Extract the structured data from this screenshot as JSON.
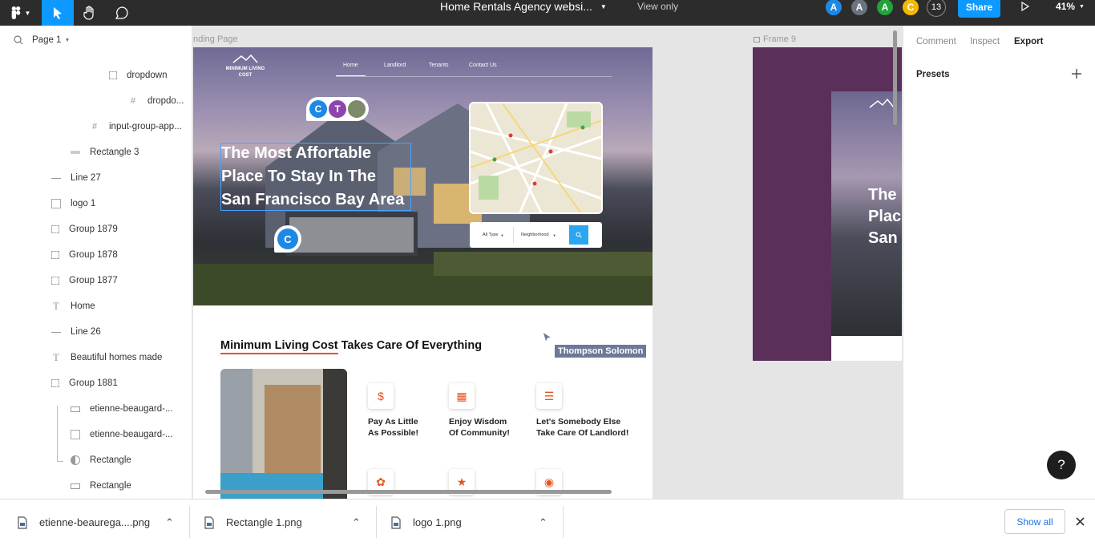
{
  "toolbar": {
    "file_title": "Home Rentals Agency websi...",
    "mode": "View only",
    "avatars": [
      {
        "initial": "A",
        "color": "#1e88e5"
      },
      {
        "initial": "A",
        "color": "#6b7280"
      },
      {
        "initial": "A",
        "color": "#22a33a"
      },
      {
        "initial": "C",
        "color": "#f5b800"
      }
    ],
    "user_count": "13",
    "share_label": "Share",
    "zoom": "41%"
  },
  "layers_panel": {
    "page_label": "Page 1",
    "items": [
      {
        "label": "dropdown",
        "icon": "group-icon"
      },
      {
        "label": "dropdo...",
        "icon": "frame-icon"
      },
      {
        "label": "input-group-app...",
        "icon": "frame-icon"
      },
      {
        "label": "Rectangle 3",
        "icon": "rectangle-icon"
      },
      {
        "label": "Line 27",
        "icon": "line-icon"
      },
      {
        "label": "logo 1",
        "icon": "image-icon"
      },
      {
        "label": "Group 1879",
        "icon": "group-icon"
      },
      {
        "label": "Group 1878",
        "icon": "group-icon"
      },
      {
        "label": "Group 1877",
        "icon": "group-icon"
      },
      {
        "label": "Home",
        "icon": "text-icon"
      },
      {
        "label": "Line 26",
        "icon": "line-icon"
      },
      {
        "label": "Beautiful homes made",
        "icon": "text-icon"
      },
      {
        "label": "Group 1881",
        "icon": "group-icon"
      },
      {
        "label": "etienne-beaugard-...",
        "icon": "rectangle-icon"
      },
      {
        "label": "etienne-beaugard-...",
        "icon": "image-icon"
      },
      {
        "label": "Rectangle",
        "icon": "ellipse-icon"
      },
      {
        "label": "Rectangle",
        "icon": "rectangle-icon"
      }
    ]
  },
  "canvas": {
    "frame_label": "nding Page",
    "frame9_label": "Frame 9",
    "site": {
      "logo_text": "MINIMUM LIVING COST",
      "nav": [
        "Home",
        "Landlord",
        "Tenants",
        "Contact Us"
      ],
      "hero_title_lines": [
        "The Most Affortable",
        "Place To Stay In The",
        "San Francisco Bay Area"
      ],
      "comment_avatars": [
        "C",
        "T"
      ],
      "comment_pin": "C",
      "search_type": "All Type",
      "search_neighborhood": "Neighborhood",
      "section_title_highlight": "Minimum Living Cost",
      "section_title_rest": " Takes Care Of Everything",
      "features": [
        {
          "line1": "Pay As Little",
          "line2": "As Possible!",
          "icon": "dollar-icon"
        },
        {
          "line1": "Enjoy Wisdom",
          "line2": "Of Community!",
          "icon": "community-icon"
        },
        {
          "line1": "Let's Somebody Else",
          "line2": "Take Care Of Landlord!",
          "icon": "layers-icon"
        }
      ]
    },
    "cursor_user": "Thompson Solomon",
    "frame9_title_lines": [
      "The",
      "Plac",
      "San"
    ]
  },
  "right_panel": {
    "tabs": [
      "Comment",
      "Inspect",
      "Export"
    ],
    "active_tab": "Export",
    "presets_label": "Presets"
  },
  "help_label": "?",
  "downloads": {
    "files": [
      "etienne-beaurega....png",
      "Rectangle 1.png",
      "logo 1.png"
    ],
    "show_all": "Show all"
  },
  "colors": {
    "accent": "#0d99ff",
    "toolbar": "#2c2c2c",
    "brand_orange": "#e8531f",
    "frame9_purple": "#5a2f5a"
  }
}
